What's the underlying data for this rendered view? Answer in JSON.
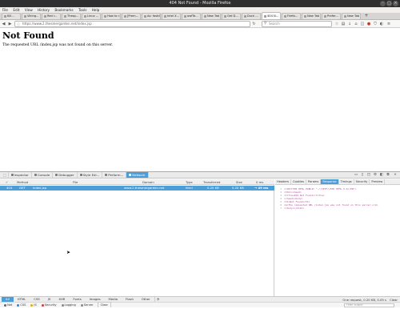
{
  "window": {
    "title": "404 Not Found - Mozilla Firefox"
  },
  "menu": [
    "File",
    "Edit",
    "View",
    "History",
    "Bookmarks",
    "Tools",
    "Help"
  ],
  "tabs": [
    {
      "label": "Kill..."
    },
    {
      "label": "Viking..."
    },
    {
      "label": "Red r..."
    },
    {
      "label": "Thesp..."
    },
    {
      "label": "Linux ..."
    },
    {
      "label": "How to r..."
    },
    {
      "label": "[Prem..."
    },
    {
      "label": "As: fastd..."
    },
    {
      "label": "Intel X..."
    },
    {
      "label": "owfTe..."
    },
    {
      "label": "New Tab"
    },
    {
      "label": "Get D..."
    },
    {
      "label": "Duck ..."
    },
    {
      "label": "404 N..."
    },
    {
      "label": "Firefo..."
    },
    {
      "label": "New Tab"
    },
    {
      "label": "Prefer..."
    },
    {
      "label": "New Tab"
    }
  ],
  "active_tab_index": 13,
  "nav": {
    "url": "https://www.2.thesmergarden.net/index.jsp",
    "search_placeholder": "Search"
  },
  "page": {
    "heading": "Not Found",
    "message": "The requested URL /index.jsp was not found on this server."
  },
  "devtools": {
    "tabs": [
      "Inspector",
      "Console",
      "Debugger",
      "Style Edi...",
      "Perform...",
      "Network"
    ],
    "active_tab": "Network",
    "columns": {
      "status": "✓",
      "method": "Method",
      "file": "File",
      "domain": "Domain",
      "type": "Type",
      "transferred": "Transferred",
      "size": "Size",
      "timeline": "0 ms"
    },
    "request": {
      "status": "404",
      "method": "GET",
      "file": "index.jsp",
      "domain": "www.2.thesmergarden.net",
      "type": "html",
      "transferred": "0.20 KB",
      "size": "0.20 KB",
      "timing": "→ 49 ms"
    },
    "detail_tabs": [
      "Headers",
      "Cookies",
      "Params",
      "Response",
      "Timings",
      "Security",
      "Preview"
    ],
    "active_detail_tab": "Response",
    "response_lines": [
      "<!DOCTYPE HTML PUBLIC \"-//IETF//DTD HTML 2.0//EN\">",
      "<html><head>",
      "<title>404 Not Found</title>",
      "</head><body>",
      "<h1>Not Found</h1>",
      "<p>The requested URL /index.jsp was not found on this server.</p>",
      "</body></html>"
    ],
    "filters": [
      "All",
      "HTML",
      "CSS",
      "JS",
      "XHR",
      "Fonts",
      "Images",
      "Media",
      "Flash",
      "Other"
    ],
    "active_filter": "All",
    "summary": "One request, 0.20 KB, 0.05 s",
    "clear_label": "Clear",
    "console_toggles": [
      {
        "label": "Net",
        "color": "#666666"
      },
      {
        "label": "CSS",
        "color": "#3b7fd6"
      },
      {
        "label": "JS",
        "color": "#e0b000"
      },
      {
        "label": "Security",
        "color": "#d23b3b"
      },
      {
        "label": "Logging",
        "color": "#888888"
      },
      {
        "label": "Server",
        "color": "#888888"
      }
    ],
    "console_clear": "Clear",
    "console_filter_placeholder": "Filter output"
  }
}
